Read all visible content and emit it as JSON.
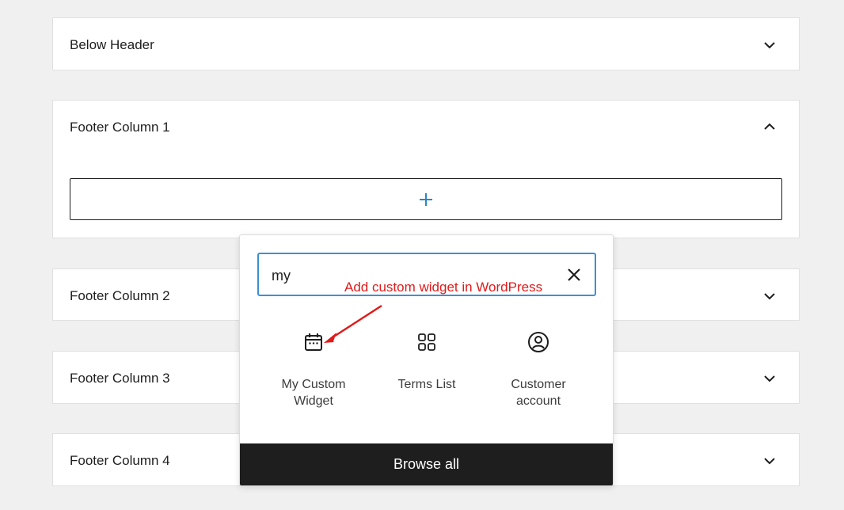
{
  "panels": {
    "below_header": {
      "title": "Below Header"
    },
    "footer_1": {
      "title": "Footer Column 1"
    },
    "footer_2": {
      "title": "Footer Column 2"
    },
    "footer_3": {
      "title": "Footer Column 3"
    },
    "footer_4": {
      "title": "Footer Column 4"
    }
  },
  "inserter": {
    "search_value": "my",
    "results": [
      {
        "label": "My Custom Widget",
        "icon": "calendar-icon"
      },
      {
        "label": "Terms List",
        "icon": "grid-icon"
      },
      {
        "label": "Customer account",
        "icon": "user-circle-icon"
      }
    ],
    "browse_all": "Browse all"
  },
  "annotation": {
    "text": "Add custom widget in WordPress",
    "color": "#e01a1a"
  },
  "colors": {
    "accent": "#3e8fd4",
    "plus": "#2a87c6",
    "dark": "#1e1e1e"
  }
}
